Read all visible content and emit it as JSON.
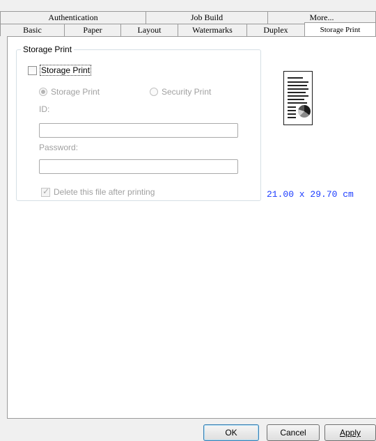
{
  "tabs_back": [
    {
      "label": "Authentication"
    },
    {
      "label": "Job Build"
    },
    {
      "label": "More..."
    }
  ],
  "tabs_front": [
    {
      "label": "Basic"
    },
    {
      "label": "Paper"
    },
    {
      "label": "Layout"
    },
    {
      "label": "Watermarks"
    },
    {
      "label": "Duplex"
    },
    {
      "label": "Storage Print",
      "active": true
    }
  ],
  "storage_group": {
    "title": "Storage Print",
    "enable_checkbox": {
      "label": "Storage Print",
      "checked": false
    },
    "radio_storage": {
      "label": "Storage Print",
      "selected": true
    },
    "radio_security": {
      "label": "Security Print",
      "selected": false
    },
    "id_label": "ID:",
    "id_value": "",
    "password_label": "Password:",
    "password_value": "",
    "delete_checkbox": {
      "label": "Delete this file after printing",
      "checked": true
    }
  },
  "preview": {
    "page_size": "21.00 x 29.70 cm",
    "icon": "document-preview-icon"
  },
  "buttons": {
    "ok": "OK",
    "cancel": "Cancel",
    "apply": "Apply"
  },
  "colors": {
    "size_text": "#1c3cff",
    "default_button_border": "#3c7fb1"
  }
}
